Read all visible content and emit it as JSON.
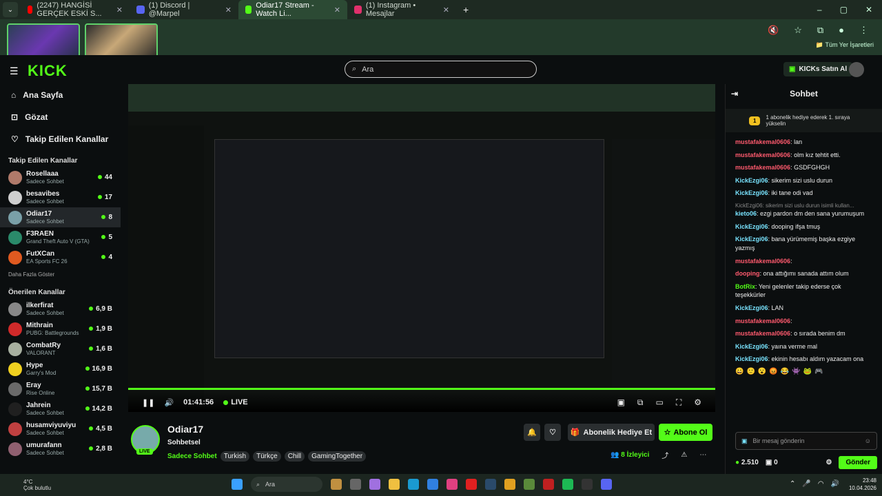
{
  "browser": {
    "tabs": [
      {
        "label": "(2247) HANGİSİ GERÇEK ESKİ S...",
        "color": "#ff0000",
        "active": false
      },
      {
        "label": "(1) Discord | @Marpel",
        "color": "#5865f2",
        "active": false
      },
      {
        "label": "Odiar17 Stream - Watch Li...",
        "color": "#53fc18",
        "active": true
      },
      {
        "label": "(1) Instagram • Mesajlar",
        "color": "#e1306c",
        "active": false
      }
    ],
    "bookmarks_label": "Tüm Yer İşaretleri"
  },
  "header": {
    "logo": "KICK",
    "search_placeholder": "Ara",
    "kicks_button": "KICKs Satın Al"
  },
  "sidebar": {
    "nav": [
      {
        "label": "Ana Sayfa",
        "icon": "home-icon"
      },
      {
        "label": "Gözat",
        "icon": "browse-icon"
      },
      {
        "label": "Takip Edilen Kanallar",
        "icon": "heart-icon"
      }
    ],
    "followed_title": "Takip Edilen Kanallar",
    "followed": [
      {
        "name": "Rosellaaa",
        "game": "Sadece Sohbet",
        "viewers": "44",
        "color": "#b07a6a"
      },
      {
        "name": "besavibes",
        "game": "Sadece Sohbet",
        "viewers": "17",
        "color": "#cfcfcf"
      },
      {
        "name": "Odiar17",
        "game": "Sadece Sohbet",
        "viewers": "8",
        "color": "#7aa0a8",
        "active": true
      },
      {
        "name": "F3RAEN",
        "game": "Grand Theft Auto V (GTA)",
        "viewers": "5",
        "color": "#2a8a6a"
      },
      {
        "name": "FutXCan",
        "game": "EA Sports FC 26",
        "viewers": "4",
        "color": "#e05a20"
      }
    ],
    "more_label": "Daha Fazla Göster",
    "suggested_title": "Önerilen Kanallar",
    "suggested": [
      {
        "name": "ilkerfirat",
        "game": "Sadece Sohbet",
        "viewers": "6,9 B",
        "color": "#888888"
      },
      {
        "name": "Mithrain",
        "game": "PUBG: Battlegrounds",
        "viewers": "1,9 B",
        "color": "#d02a2a"
      },
      {
        "name": "CombatRy",
        "game": "VALORANT",
        "viewers": "1,6 B",
        "color": "#a8b0a0"
      },
      {
        "name": "Hype",
        "game": "Garry's Mod",
        "viewers": "16,9 B",
        "color": "#f0d020"
      },
      {
        "name": "Eray",
        "game": "Rise Online",
        "viewers": "15,7 B",
        "color": "#6a6a6a"
      },
      {
        "name": "Jahrein",
        "game": "Sadece Sohbet",
        "viewers": "14,2 B",
        "color": "#202020"
      },
      {
        "name": "husamviyuviyu",
        "game": "Sadece Sohbet",
        "viewers": "4,5 B",
        "color": "#c04040"
      },
      {
        "name": "umurafann",
        "game": "Sadece Sohbet",
        "viewers": "2,8 B",
        "color": "#906070"
      }
    ]
  },
  "player": {
    "time": "01:41:56",
    "live_label": "LIVE"
  },
  "stream": {
    "channel": "Odiar17",
    "category": "Sohbetsel",
    "live_badge": "LIVE",
    "main_tag": "Sadece Sohbet",
    "tags": [
      "Turkish",
      "Türkçe",
      "Chill",
      "GamingTogether"
    ],
    "gift_sub_label": "Abonelik Hediye Et",
    "subscribe_label": "Abone Ol",
    "viewers": "8",
    "viewers_label": "İzleyici"
  },
  "chat": {
    "title": "Sohbet",
    "gift_notice": "1 abonelik hediye ederek 1. sıraya yükselin",
    "gift_count": "1",
    "messages": [
      {
        "user": "mustafakemal0606",
        "text": ": lan",
        "color": "red"
      },
      {
        "user": "mustafakemal0606",
        "text": ": olm kız tehtit etti.",
        "color": "red"
      },
      {
        "user": "mustafakemal0606",
        "text": ": GSDFGHGH",
        "color": "red"
      },
      {
        "user": "KickEzgi06",
        "text": ": sikerim sizi uslu durun",
        "color": "cyan"
      },
      {
        "user": "KickEzgi06",
        "text": ": iki tane odi vad",
        "color": "cyan"
      },
      {
        "user": "kieto06",
        "text": ": ezgi pardon dm den sana yurumuşum",
        "color": "cyan",
        "reply": "KickEzgi06: sikerim sizi uslu durun isimli kullan..."
      },
      {
        "user": "KickEzgi06",
        "text": ": dooping ifşa tmuş",
        "color": "cyan"
      },
      {
        "user": "KickEzgi06",
        "text": ": bana yürümemiş başka ezgiye yazmış",
        "color": "cyan"
      },
      {
        "user": "mustafakemal0606",
        "text": ":",
        "color": "red"
      },
      {
        "user": "dooping",
        "text": ": ona attığımı sanada attım olum",
        "color": "red"
      },
      {
        "user": "BotRix",
        "text": ": Yeni gelenler takip ederse çok teşekkürler",
        "color": "green"
      },
      {
        "user": "KickEzgi06",
        "text": ": LAN",
        "color": "cyan"
      },
      {
        "user": "mustafakemal0606",
        "text": ":",
        "color": "red"
      },
      {
        "user": "mustafakemal0606",
        "text": ": o sırada benim dm",
        "color": "red"
      },
      {
        "user": "KickEzgi06",
        "text": ": yaına verme mal",
        "color": "cyan"
      },
      {
        "user": "KickEzgi06",
        "text": ": ekinin hesabı aldım yazacam ona",
        "color": "cyan"
      }
    ],
    "input_placeholder": "Bir mesaj gönderin",
    "points": "2.510",
    "zero": "0",
    "send_label": "Gönder"
  },
  "taskbar": {
    "temp": "4°C",
    "weather": "Çok bulutlu",
    "search_placeholder": "Ara",
    "time": "23:48",
    "date": "10.04.2026"
  },
  "colors": {
    "accent": "#53fc18",
    "background": "#0b0e0f"
  }
}
